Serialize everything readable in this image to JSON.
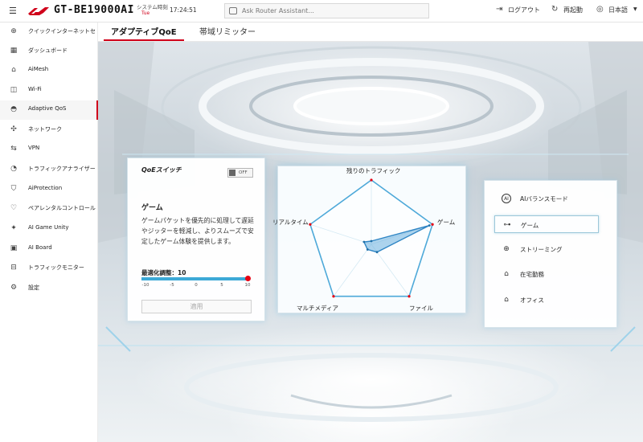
{
  "header": {
    "model": "GT-BE19000AI",
    "system_time_label": "システム時刻",
    "system_time_sub": "Tue",
    "system_time": "17:24:51",
    "assistant_placeholder": "Ask Router Assistant...",
    "logout": "ログアウト",
    "reboot": "再起動",
    "language": "日本語"
  },
  "sidebar": {
    "items": [
      {
        "label": "クイックインターネットセ",
        "icon": "globe-icon"
      },
      {
        "label": "ダッシュボード",
        "icon": "dashboard-icon"
      },
      {
        "label": "AiMesh",
        "icon": "mesh-icon"
      },
      {
        "label": "Wi-Fi",
        "icon": "wifi-icon"
      },
      {
        "label": "Adaptive QoS",
        "icon": "qos-icon"
      },
      {
        "label": "ネットワーク",
        "icon": "network-icon"
      },
      {
        "label": "VPN",
        "icon": "vpn-icon"
      },
      {
        "label": "トラフィックアナライザー",
        "icon": "analyzer-icon"
      },
      {
        "label": "AiProtection",
        "icon": "shield-icon"
      },
      {
        "label": "ペアレンタルコントロール",
        "icon": "parental-icon"
      },
      {
        "label": "AI Game Unity",
        "icon": "game-unity-icon"
      },
      {
        "label": "AI Board",
        "icon": "ai-board-icon"
      },
      {
        "label": "トラフィックモニター",
        "icon": "monitor-icon"
      },
      {
        "label": "設定",
        "icon": "gear-icon"
      }
    ]
  },
  "tabs": [
    {
      "label": "アダプティブQoE"
    },
    {
      "label": "帯域リミッター"
    }
  ],
  "qoe": {
    "switch_label": "QoEスイッチ",
    "switch_state": "OFF",
    "mode_name": "ゲーム",
    "description": "ゲームパケットを優先的に処理して遅延やジッターを軽減し、よりスムーズで安定したゲーム体験を提供します。",
    "tune_label": "最適化調整：10",
    "slider_value": 10,
    "slider_min": -10,
    "slider_max": 10,
    "slider_ticks": [
      "-10",
      "-5",
      "0",
      "5",
      "10"
    ],
    "apply": "適用"
  },
  "radar": {
    "labels": [
      "残りのトラフィック",
      "ゲーム",
      "ファイル",
      "マルチメディア",
      "リアルタイム"
    ],
    "values": [
      0.05,
      0.95,
      0.15,
      0.1,
      0.12
    ]
  },
  "modes": [
    {
      "label": "AIバランスモード",
      "icon": "ai-icon",
      "selected": false
    },
    {
      "label": "ゲーム",
      "icon": "gamepad-icon",
      "selected": true
    },
    {
      "label": "ストリーミング",
      "icon": "streaming-icon",
      "selected": false
    },
    {
      "label": "在宅勤務",
      "icon": "home-work-icon",
      "selected": false
    },
    {
      "label": "オフィス",
      "icon": "office-icon",
      "selected": false
    }
  ],
  "colors": {
    "accent": "#d0021b",
    "slider": "#3ca9d6",
    "radar_fill": "#6aaede"
  }
}
